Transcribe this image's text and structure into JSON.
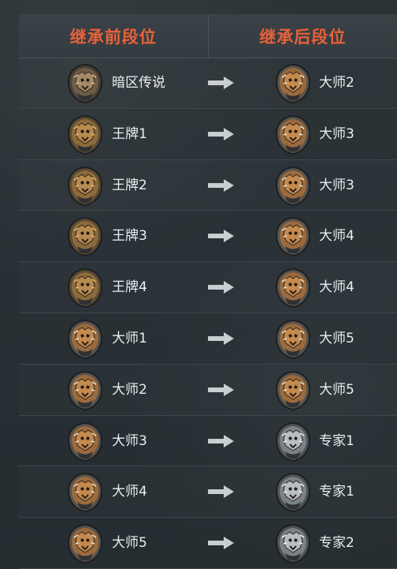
{
  "header": {
    "before_title": "继承前段位",
    "after_title": "继承后段位"
  },
  "rows": [
    {
      "from": {
        "label": "暗区传说",
        "icon": "legend-badge-icon"
      },
      "to": {
        "label": "大师2",
        "icon": "tiger-badge-icon"
      }
    },
    {
      "from": {
        "label": "王牌1",
        "icon": "lion-badge-icon"
      },
      "to": {
        "label": "大师3",
        "icon": "tiger-badge-icon"
      }
    },
    {
      "from": {
        "label": "王牌2",
        "icon": "lion-badge-icon"
      },
      "to": {
        "label": "大师3",
        "icon": "tiger-badge-icon"
      }
    },
    {
      "from": {
        "label": "王牌3",
        "icon": "lion-badge-icon"
      },
      "to": {
        "label": "大师4",
        "icon": "tiger-badge-icon"
      }
    },
    {
      "from": {
        "label": "王牌4",
        "icon": "lion-badge-icon"
      },
      "to": {
        "label": "大师4",
        "icon": "tiger-badge-icon"
      }
    },
    {
      "from": {
        "label": "大师1",
        "icon": "tiger-badge-icon"
      },
      "to": {
        "label": "大师5",
        "icon": "tiger-badge-icon"
      }
    },
    {
      "from": {
        "label": "大师2",
        "icon": "tiger-badge-icon"
      },
      "to": {
        "label": "大师5",
        "icon": "tiger-badge-icon"
      }
    },
    {
      "from": {
        "label": "大师3",
        "icon": "tiger-badge-icon"
      },
      "to": {
        "label": "专家1",
        "icon": "wolf-badge-icon"
      }
    },
    {
      "from": {
        "label": "大师4",
        "icon": "tiger-badge-icon"
      },
      "to": {
        "label": "专家1",
        "icon": "wolf-badge-icon"
      }
    },
    {
      "from": {
        "label": "大师5",
        "icon": "tiger-badge-icon"
      },
      "to": {
        "label": "专家2",
        "icon": "wolf-badge-icon"
      }
    }
  ],
  "colors": {
    "header_text": "#e8613a",
    "text": "#e9eef1",
    "arrow": "#c9ced1"
  }
}
